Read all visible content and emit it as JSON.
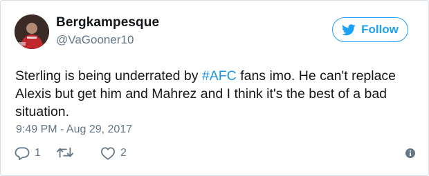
{
  "user": {
    "name": "Bergkampesque",
    "handle": "@VaGooner10"
  },
  "follow_button": {
    "label": "Follow",
    "icon": "twitter-bird-icon"
  },
  "tweet": {
    "text_before": "Sterling is being underrated by ",
    "hashtag": "#AFC",
    "text_after": " fans imo. He can't replace Alexis but get him and Mahrez and I think it's the best of a bad situation.",
    "timestamp": "9:49 PM - Aug 29, 2017"
  },
  "actions": {
    "reply_count": "1",
    "retweet_count": "",
    "like_count": "2",
    "reply_icon": "reply-icon",
    "retweet_icon": "retweet-icon",
    "like_icon": "heart-icon",
    "info_icon": "info-icon"
  },
  "colors": {
    "accent": "#1da1f2",
    "hashtag": "#1b95e0",
    "muted": "#657786",
    "text": "#14171a",
    "border": "#d5dde3"
  }
}
